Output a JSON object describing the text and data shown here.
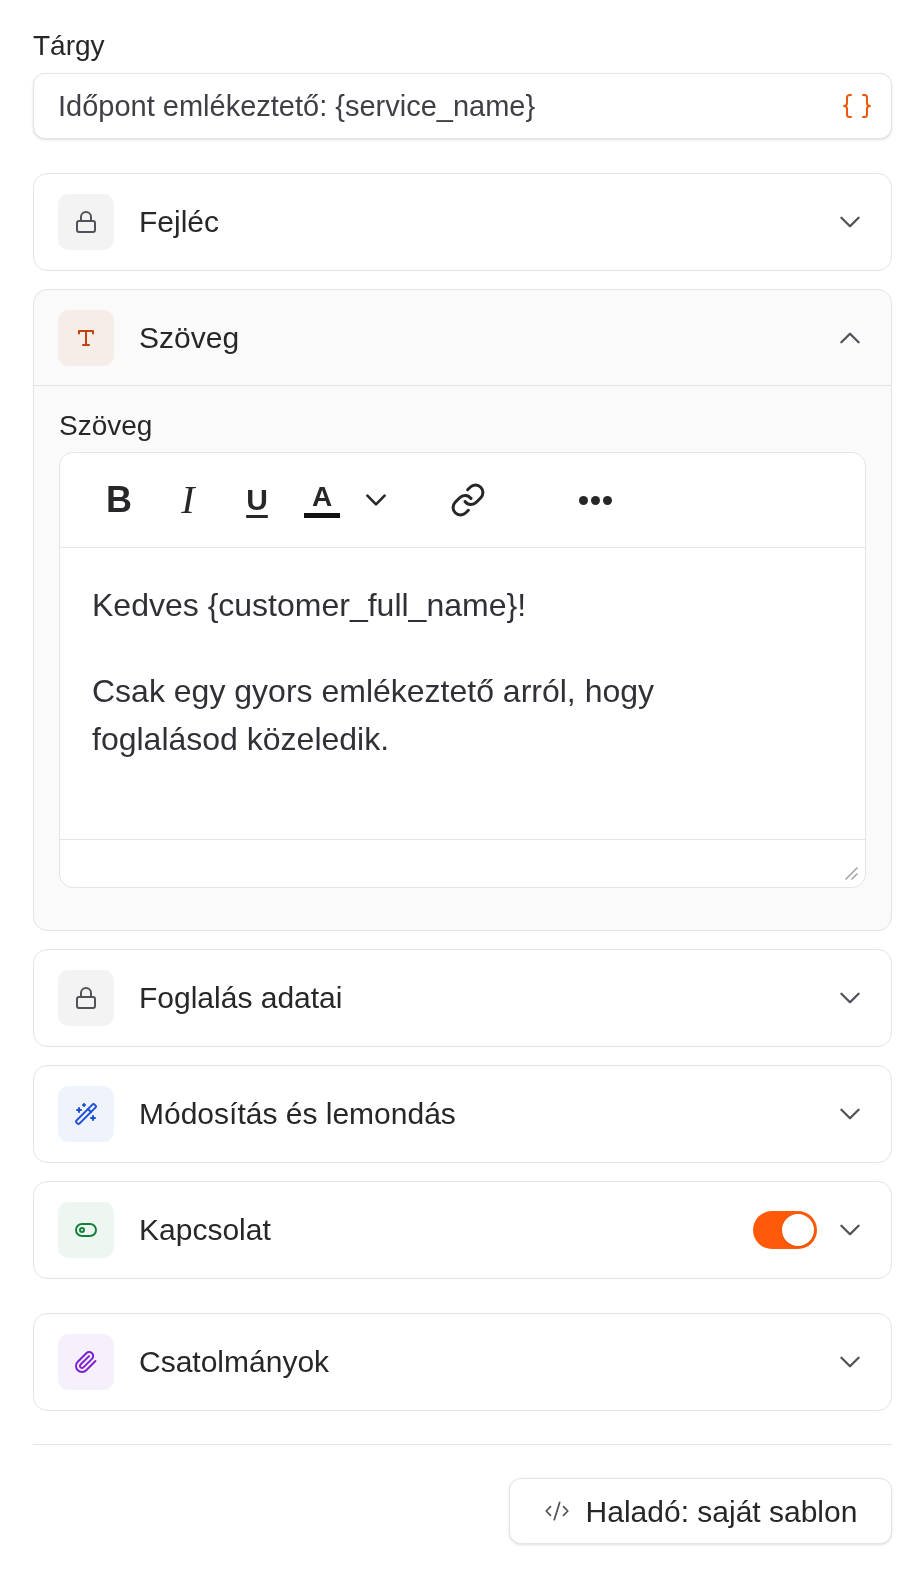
{
  "subject": {
    "label": "Tárgy",
    "value": "Időpont emlékeztető: {service_name}"
  },
  "section_groups": [
    {
      "sections": [
        {
          "kind": "locked",
          "title": "Fejléc",
          "color": "#52525b",
          "expanded": false
        },
        {
          "kind": "text",
          "title": "Szöveg",
          "color": "#c2410c",
          "expanded": true,
          "body": {
            "label": "Szöveg",
            "toolbar_groups": [
              {
                "buttons": [
                  {
                    "kind": "bold",
                    "label": "B"
                  },
                  {
                    "kind": "italic",
                    "label": "I"
                  },
                  {
                    "kind": "underline",
                    "label": "U"
                  },
                  {
                    "kind": "textcolor",
                    "label": "A",
                    "color": "#111111"
                  }
                ]
              },
              {
                "buttons": [
                  {
                    "kind": "link"
                  }
                ]
              },
              {
                "buttons": [
                  {
                    "kind": "more"
                  }
                ]
              }
            ],
            "paragraphs": [
              "Kedves {customer_full_name}!",
              "Csak egy gyors emlékeztető arról, hogy foglalásod közeledik."
            ]
          }
        },
        {
          "kind": "locked",
          "title": "Foglalás adatai",
          "color": "#52525b",
          "expanded": false
        },
        {
          "kind": "actions",
          "title": "Módosítás és lemondás",
          "color": "#1d4ed8",
          "expanded": false
        },
        {
          "kind": "contact",
          "title": "Kapcsolat",
          "color": "#15803d",
          "expanded": false,
          "on": true
        }
      ]
    },
    {
      "sections": [
        {
          "kind": "attachments",
          "title": "Csatolmányok",
          "color": "#7e22ce",
          "expanded": false
        }
      ]
    }
  ],
  "advanced_button": {
    "label": "Haladó: saját sablon"
  }
}
